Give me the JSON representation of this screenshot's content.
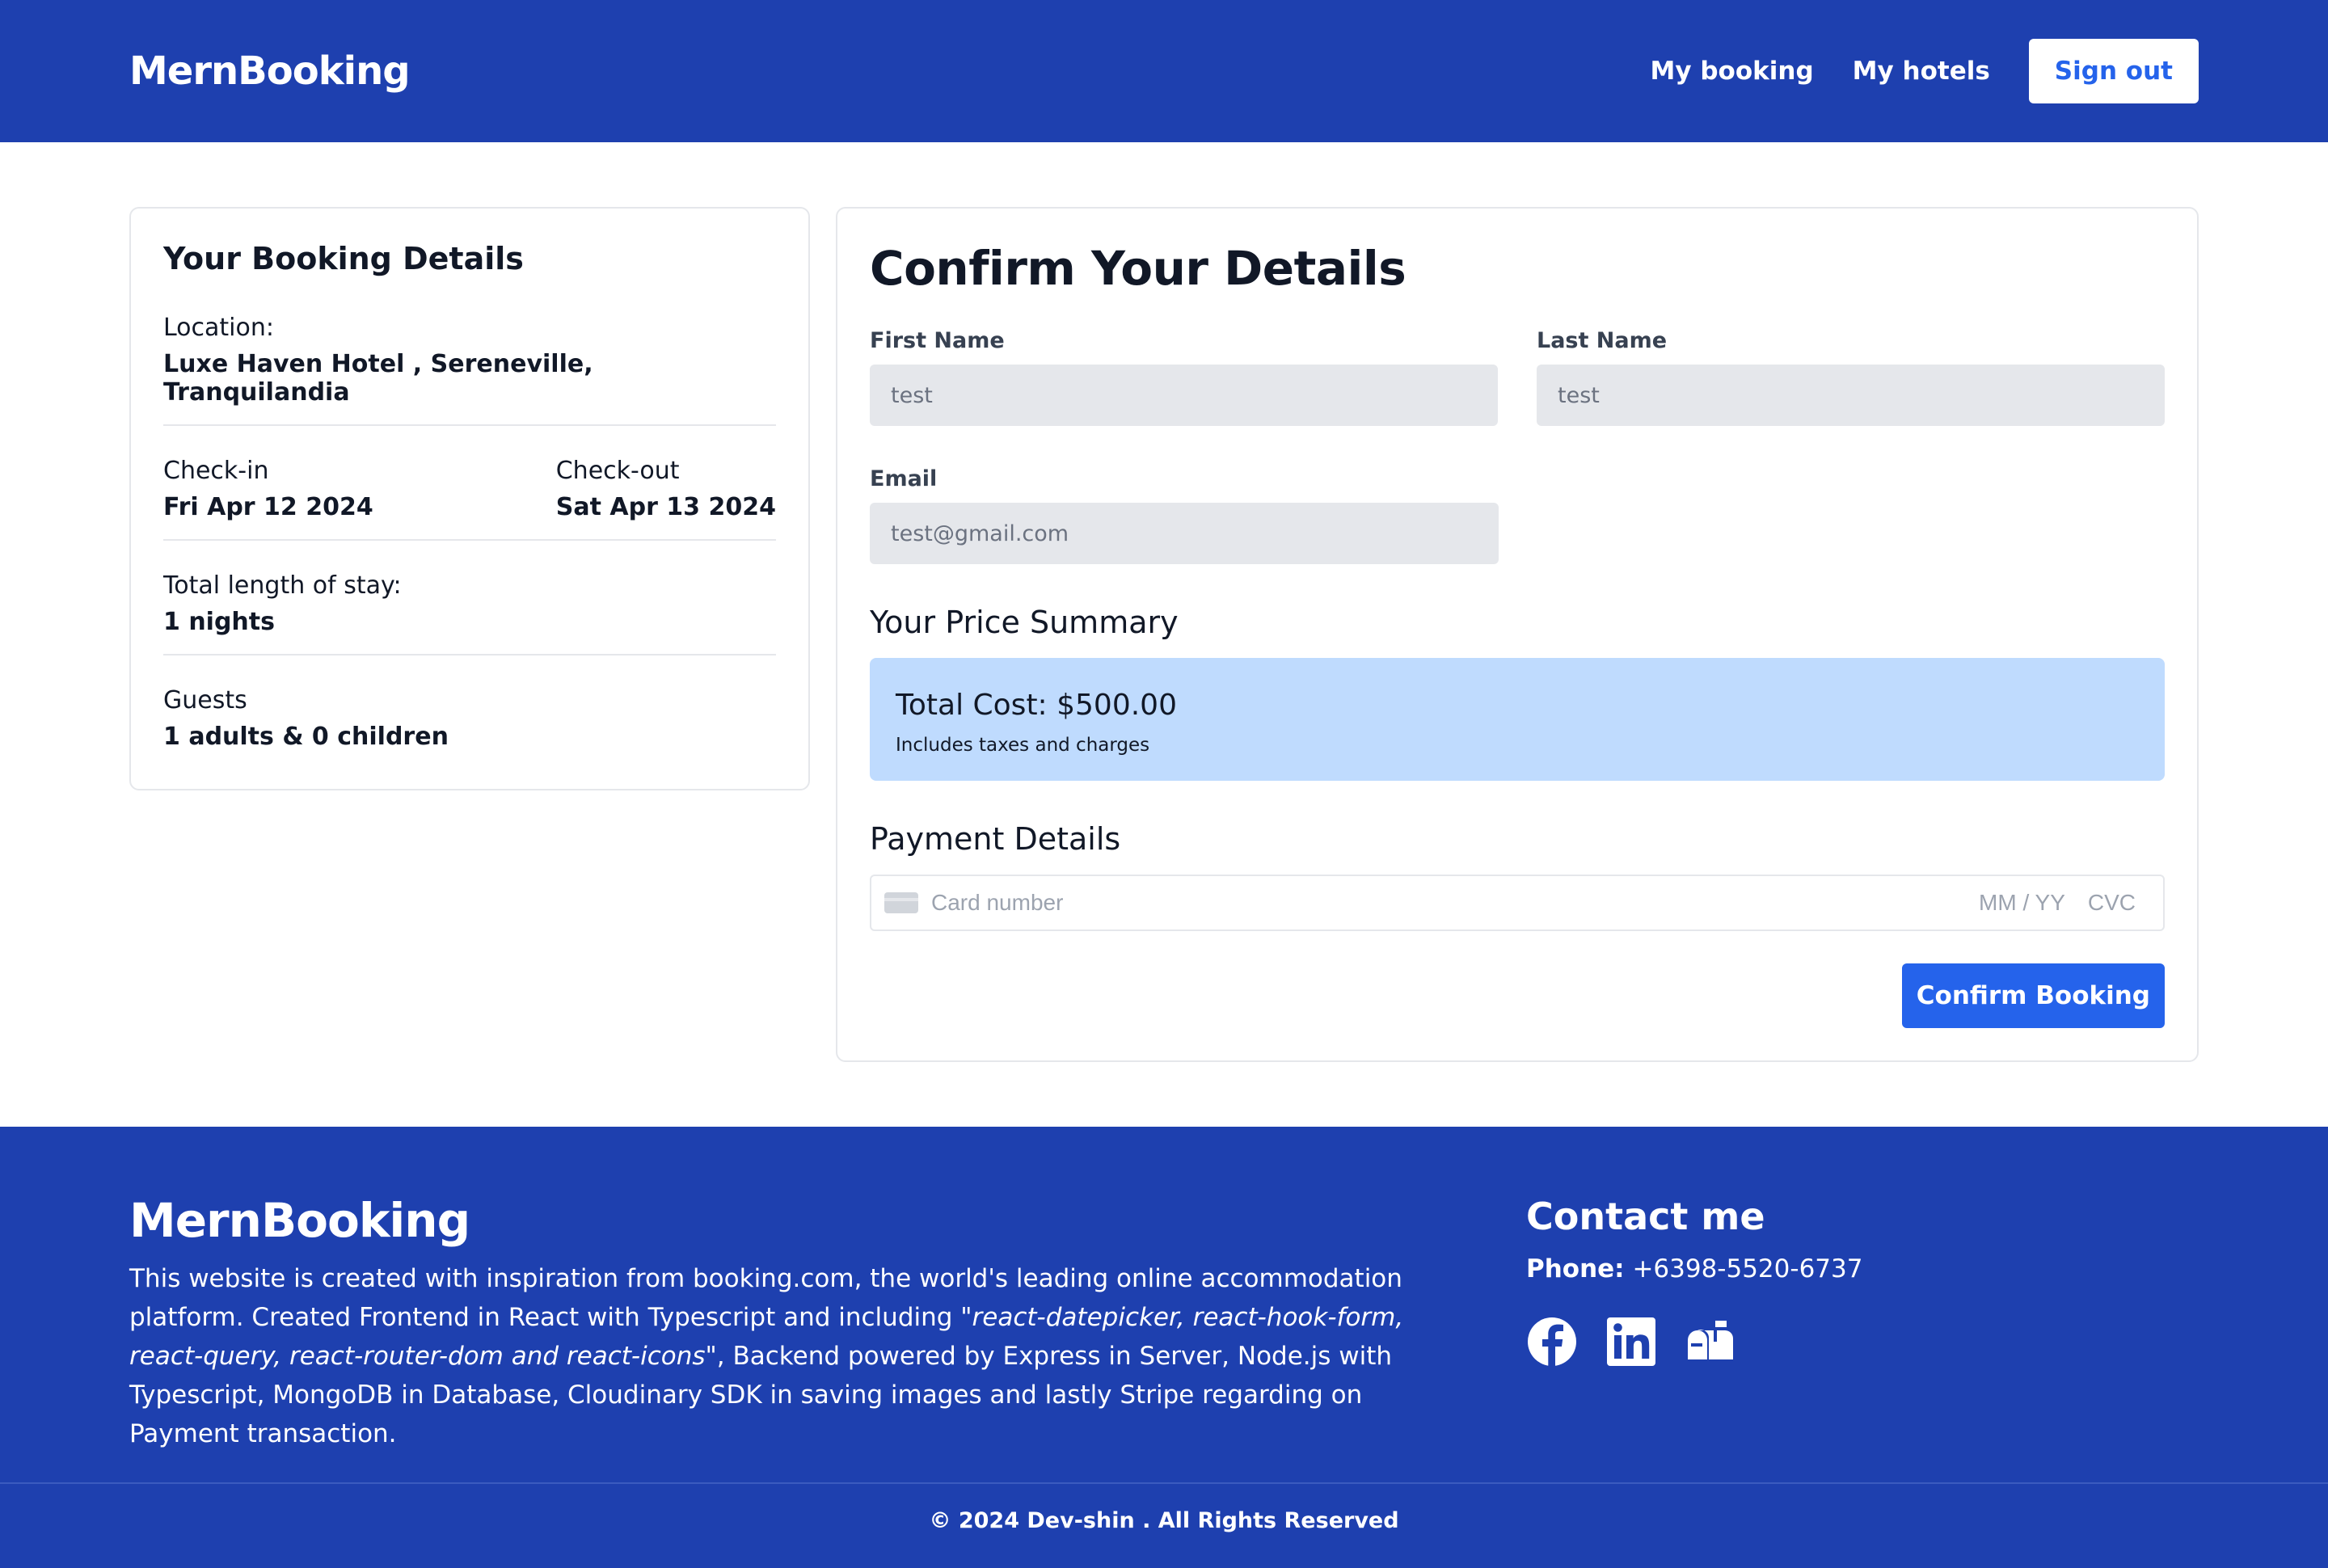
{
  "header": {
    "brand": "MernBooking",
    "nav": [
      "My booking",
      "My hotels"
    ],
    "sign_out": "Sign out"
  },
  "booking_details": {
    "title": "Your Booking Details",
    "location_label": "Location:",
    "location_value": "Luxe Haven Hotel , Sereneville, Tranquilandia",
    "checkin_label": "Check-in",
    "checkin_value": "Fri Apr 12 2024",
    "checkout_label": "Check-out",
    "checkout_value": "Sat Apr 13 2024",
    "stay_label": "Total length of stay:",
    "stay_value": "1 nights",
    "guests_label": "Guests",
    "guests_value": "1 adults & 0 children"
  },
  "form": {
    "title": "Confirm Your Details",
    "first_name_label": "First Name",
    "first_name_value": "test",
    "last_name_label": "Last Name",
    "last_name_value": "test",
    "email_label": "Email",
    "email_value": "test@gmail.com",
    "price_title": "Your Price Summary",
    "total_cost": "Total Cost: $500.00",
    "price_note": "Includes taxes and charges",
    "payment_title": "Payment Details",
    "card_placeholder": "Card number",
    "expiry_placeholder": "MM / YY",
    "cvc_placeholder": "CVC",
    "confirm_button": "Confirm Booking"
  },
  "footer": {
    "brand": "MernBooking",
    "desc_1": "This website is created with inspiration from booking.com, the world's leading online accommodation platform. Created Frontend in React with Typescript and including \"",
    "desc_em": "react-datepicker, react-hook-form, react-query, react-router-dom and react-icons",
    "desc_2": "\", Backend powered by Express in Server, Node.js with Typescript, MongoDB in Database, Cloudinary SDK in saving images and lastly Stripe regarding on Payment transaction.",
    "contact_title": "Contact me",
    "phone_label": "Phone:",
    "phone_value": "+6398-5520-6737",
    "socials": [
      "facebook-icon",
      "linkedin-icon",
      "mailbox-icon"
    ],
    "copyright": "© 2024 Dev-shin . All Rights Reserved"
  },
  "colors": {
    "primary": "#1e40af",
    "button": "#2563eb",
    "price_bg": "#bfdbfe"
  }
}
